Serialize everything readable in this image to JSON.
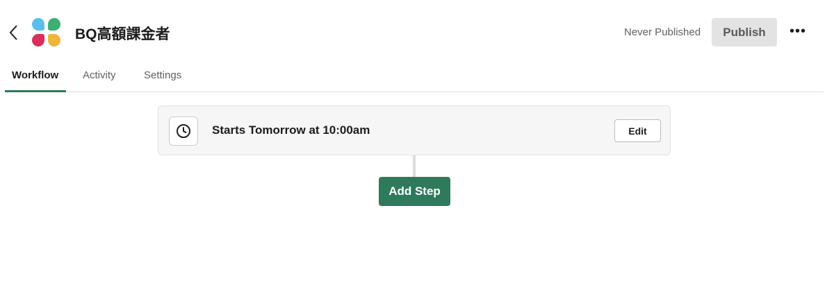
{
  "header": {
    "title": "BQ高額課金者",
    "status": "Never Published",
    "publish_label": "Publish",
    "more_label": "•••"
  },
  "tabs": [
    {
      "label": "Workflow",
      "active": true
    },
    {
      "label": "Activity"
    },
    {
      "label": "Settings"
    }
  ],
  "trigger": {
    "text": "Starts Tomorrow at 10:00am",
    "edit_label": "Edit"
  },
  "add_step_label": "Add Step",
  "colors": {
    "accent": "#2f7a5b",
    "logo": [
      "#5bbfea",
      "#3fae73",
      "#d8305a",
      "#ecb53c"
    ]
  }
}
